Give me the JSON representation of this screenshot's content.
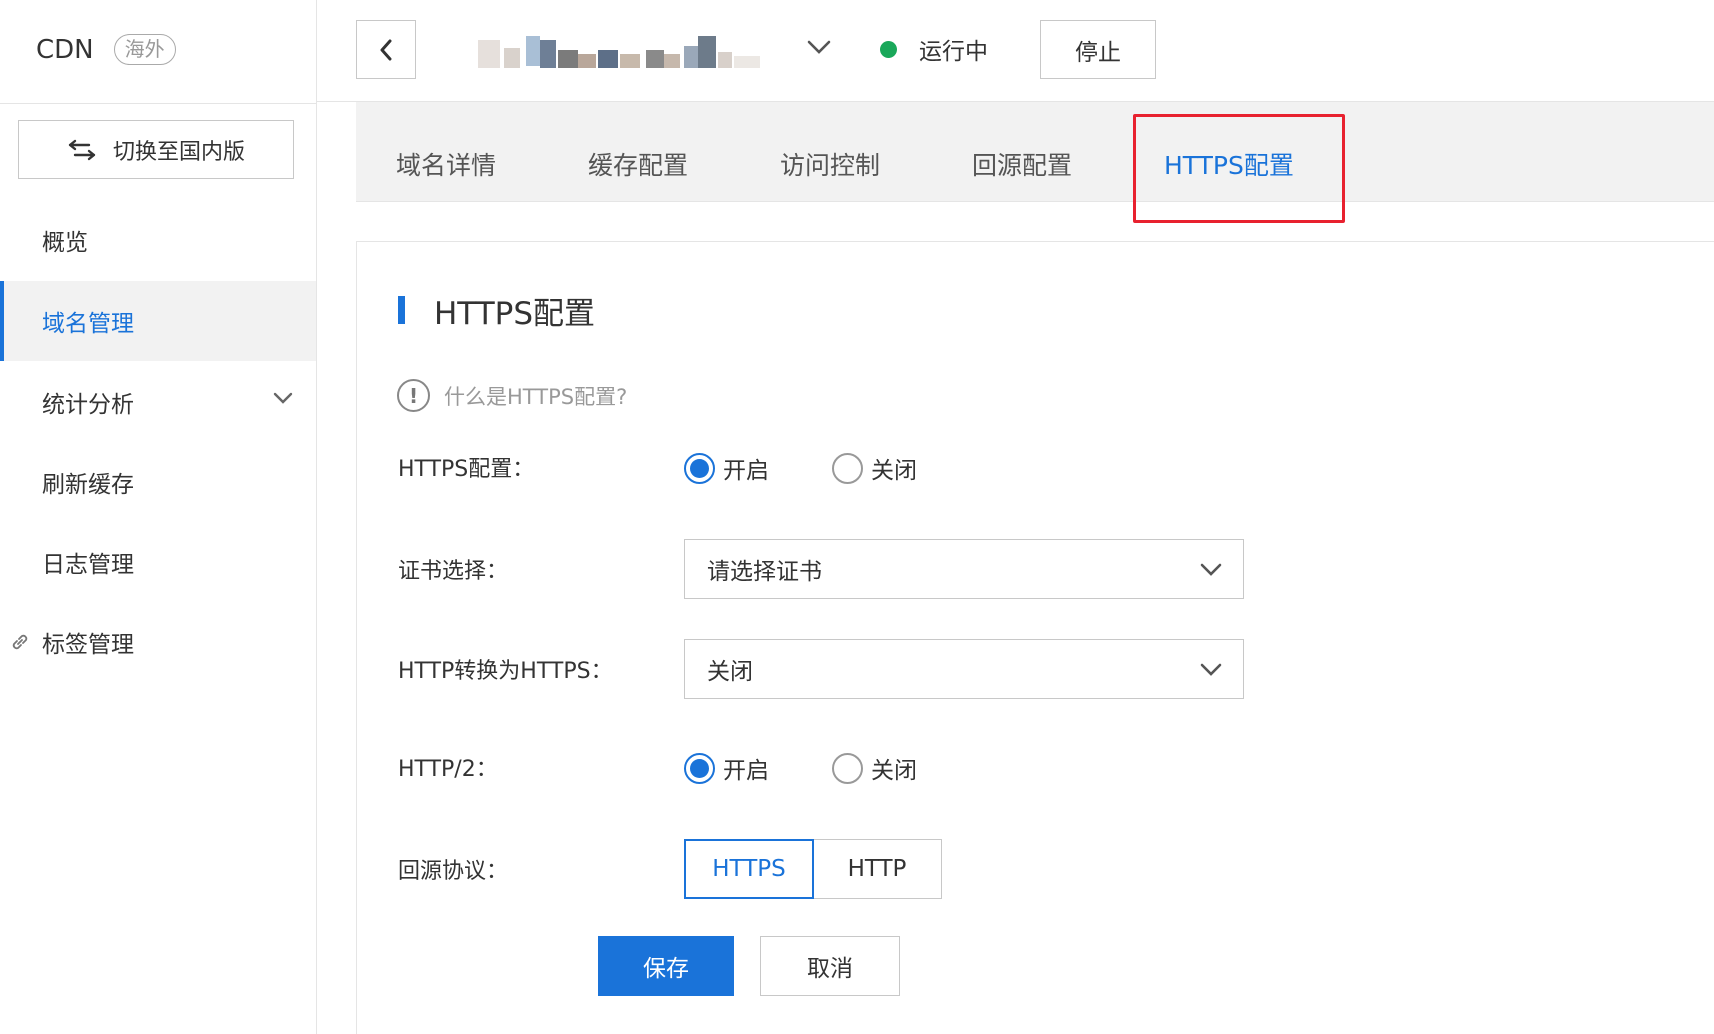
{
  "sidebar": {
    "brand_title": "CDN",
    "brand_badge": "海外",
    "switch_label": "切换至国内版",
    "items": [
      {
        "label": "概览"
      },
      {
        "label": "域名管理"
      },
      {
        "label": "统计分析"
      },
      {
        "label": "刷新缓存"
      },
      {
        "label": "日志管理"
      },
      {
        "label": "标签管理"
      }
    ]
  },
  "topbar": {
    "status_text": "运行中",
    "stop_label": "停止",
    "status_color": "#1aa85a"
  },
  "tabs": [
    {
      "label": "域名详情"
    },
    {
      "label": "缓存配置"
    },
    {
      "label": "访问控制"
    },
    {
      "label": "回源配置"
    },
    {
      "label": "HTTPS配置"
    }
  ],
  "content": {
    "section_title": "HTTPS配置",
    "help_text": "什么是HTTPS配置?",
    "https_config": {
      "label": "HTTPS配置：",
      "option_on": "开启",
      "option_off": "关闭",
      "selected": "开启"
    },
    "certificate": {
      "label": "证书选择：",
      "value": "请选择证书"
    },
    "http_to_https": {
      "label": "HTTP转换为HTTPS：",
      "value": "关闭"
    },
    "http2": {
      "label": "HTTP/2：",
      "option_on": "开启",
      "option_off": "关闭",
      "selected": "开启"
    },
    "origin_protocol": {
      "label": "回源协议：",
      "options": [
        "HTTPS",
        "HTTP"
      ],
      "selected": "HTTPS"
    },
    "save_label": "保存",
    "cancel_label": "取消"
  },
  "colors": {
    "accent": "#1a73d9",
    "highlight_border": "#e8212f"
  }
}
